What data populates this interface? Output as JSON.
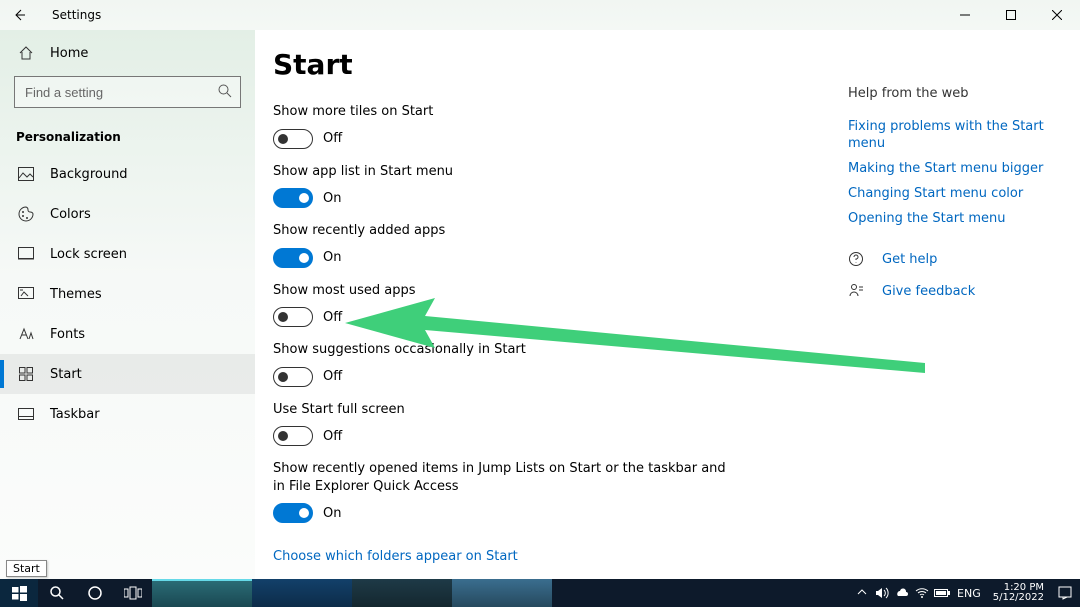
{
  "titlebar": {
    "title": "Settings"
  },
  "sidebar": {
    "home": "Home",
    "search_placeholder": "Find a setting",
    "category": "Personalization",
    "items": [
      {
        "label": "Background"
      },
      {
        "label": "Colors"
      },
      {
        "label": "Lock screen"
      },
      {
        "label": "Themes"
      },
      {
        "label": "Fonts"
      },
      {
        "label": "Start"
      },
      {
        "label": "Taskbar"
      }
    ]
  },
  "page": {
    "heading": "Start",
    "settings": [
      {
        "label": "Show more tiles on Start",
        "on": false,
        "state": "Off"
      },
      {
        "label": "Show app list in Start menu",
        "on": true,
        "state": "On"
      },
      {
        "label": "Show recently added apps",
        "on": true,
        "state": "On"
      },
      {
        "label": "Show most used apps",
        "on": false,
        "state": "Off"
      },
      {
        "label": "Show suggestions occasionally in Start",
        "on": false,
        "state": "Off"
      },
      {
        "label": "Use Start full screen",
        "on": false,
        "state": "Off"
      },
      {
        "label": "Show recently opened items in Jump Lists on Start or the taskbar and in File Explorer Quick Access",
        "on": true,
        "state": "On"
      }
    ],
    "link": "Choose which folders appear on Start"
  },
  "help": {
    "title": "Help from the web",
    "links": [
      "Fixing problems with the Start menu",
      "Making the Start menu bigger",
      "Changing Start menu color",
      "Opening the Start menu"
    ],
    "actions": {
      "get_help": "Get help",
      "feedback": "Give feedback"
    }
  },
  "tooltip": "Start",
  "taskbar": {
    "lang": "ENG",
    "time": "1:20 PM",
    "date": "5/12/2022"
  }
}
